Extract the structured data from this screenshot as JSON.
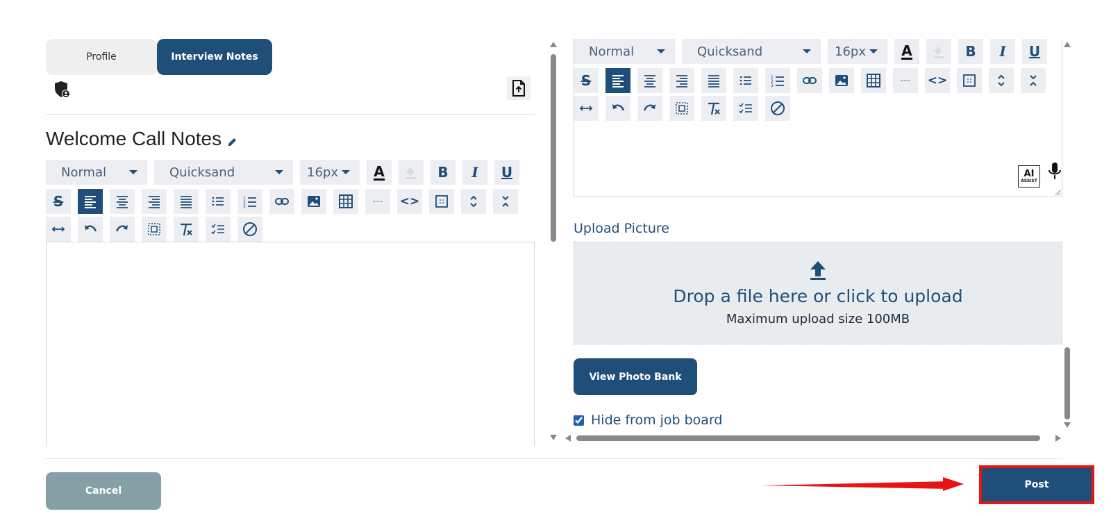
{
  "tabs": {
    "profile": "Profile",
    "notes": "Interview Notes"
  },
  "title": "Welcome Call Notes",
  "toolbar": {
    "format": "Normal",
    "font": "Quicksand",
    "size": "16px",
    "bold": "B",
    "italic": "I",
    "underline": "U",
    "color_letter": "A",
    "hr": "---",
    "code": "<>"
  },
  "ai": {
    "label": "AI",
    "sub": "ASSIST"
  },
  "upload": {
    "label": "Upload Picture",
    "drop_text": "Drop a file here or click to upload",
    "max_size": "Maximum upload size 100MB"
  },
  "photo_bank": "View Photo Bank",
  "hide_from_board": "Hide from job board",
  "buttons": {
    "cancel": "Cancel",
    "post": "Post"
  },
  "colors": {
    "navy": "#1f4e79",
    "cancel": "#87a0a8",
    "highlight": "#e81414"
  }
}
